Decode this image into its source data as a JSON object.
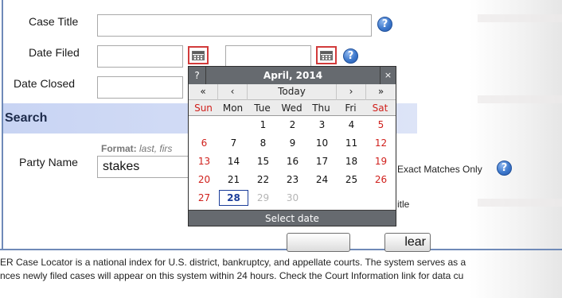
{
  "form": {
    "case_title_label": "Case Title",
    "date_filed_label": "Date Filed",
    "date_closed_label": "Date Closed",
    "case_title_value": "",
    "date_filed_from": "",
    "date_filed_to": "",
    "date_closed_from": "",
    "help_glyph": "?"
  },
  "party_search": {
    "section_title_visible": "Search",
    "party_name_label": "Party Name",
    "format_prefix": "Format:",
    "format_hint": "last, firs",
    "party_name_value": "stakes",
    "exact_matches_label": "Exact Matches Only",
    "title_option_visible": "itle"
  },
  "buttons": {
    "clear_visible": "lear"
  },
  "footer": {
    "line1": "ER Case Locator is a national index for U.S. district, bankruptcy, and appellate courts. The system serves as a",
    "line2": "nces newly filed cases will appear on this system within 24 hours. Check the Court Information link for data cu"
  },
  "calendar": {
    "help": "?",
    "month_year": "April, 2014",
    "close": "×",
    "nav": [
      "«",
      "‹",
      "Today",
      "›",
      "»"
    ],
    "weekdays": [
      "Sun",
      "Mon",
      "Tue",
      "Wed",
      "Thu",
      "Fri",
      "Sat"
    ],
    "weeks": [
      [
        "",
        "",
        "1",
        "2",
        "3",
        "4",
        "5"
      ],
      [
        "6",
        "7",
        "8",
        "9",
        "10",
        "11",
        "12"
      ],
      [
        "13",
        "14",
        "15",
        "16",
        "17",
        "18",
        "19"
      ],
      [
        "20",
        "21",
        "22",
        "23",
        "24",
        "25",
        "26"
      ],
      [
        "27",
        "28",
        "29",
        "30",
        "",
        "",
        ""
      ]
    ],
    "today": "28",
    "footer": "Select date",
    "colors": {
      "header_bg": "#666a6f",
      "weekend": "#d0201c",
      "today_outline": "#1b3d9a"
    }
  },
  "icons": [
    "help-icon",
    "calendar-icon"
  ]
}
